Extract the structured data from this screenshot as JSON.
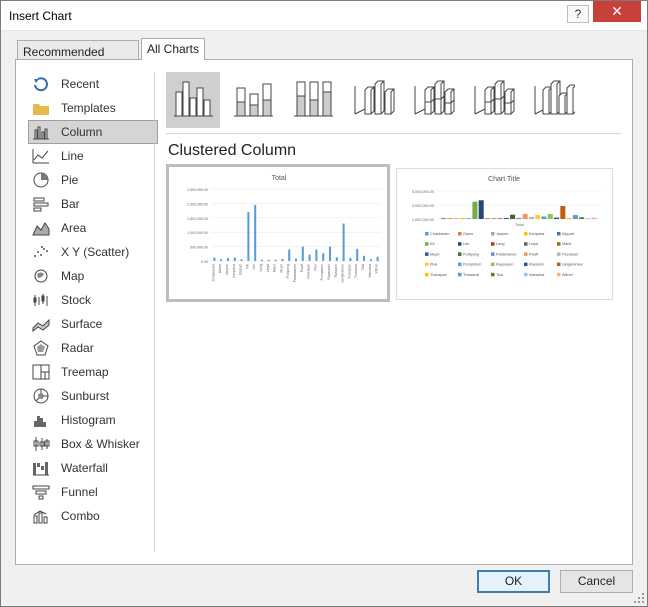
{
  "window": {
    "title": "Insert Chart",
    "help_glyph": "?",
    "close_glyph": "✕"
  },
  "tabs": [
    {
      "label": "Recommended Charts",
      "active": false
    },
    {
      "label": "All Charts",
      "active": true
    }
  ],
  "sidebar": {
    "selected": "Column",
    "items": [
      {
        "label": "Recent",
        "icon": "recent-icon"
      },
      {
        "label": "Templates",
        "icon": "folder-icon"
      },
      {
        "label": "Column",
        "icon": "column-chart-icon"
      },
      {
        "label": "Line",
        "icon": "line-chart-icon"
      },
      {
        "label": "Pie",
        "icon": "pie-chart-icon"
      },
      {
        "label": "Bar",
        "icon": "bar-chart-icon"
      },
      {
        "label": "Area",
        "icon": "area-chart-icon"
      },
      {
        "label": "X Y (Scatter)",
        "icon": "scatter-chart-icon"
      },
      {
        "label": "Map",
        "icon": "map-chart-icon"
      },
      {
        "label": "Stock",
        "icon": "stock-chart-icon"
      },
      {
        "label": "Surface",
        "icon": "surface-chart-icon"
      },
      {
        "label": "Radar",
        "icon": "radar-chart-icon"
      },
      {
        "label": "Treemap",
        "icon": "treemap-chart-icon"
      },
      {
        "label": "Sunburst",
        "icon": "sunburst-chart-icon"
      },
      {
        "label": "Histogram",
        "icon": "histogram-chart-icon"
      },
      {
        "label": "Box & Whisker",
        "icon": "box-whisker-chart-icon"
      },
      {
        "label": "Waterfall",
        "icon": "waterfall-chart-icon"
      },
      {
        "label": "Funnel",
        "icon": "funnel-chart-icon"
      },
      {
        "label": "Combo",
        "icon": "combo-chart-icon"
      }
    ]
  },
  "subtypes": {
    "selected_index": 0,
    "icons": [
      "clustered-column-icon",
      "stacked-column-icon",
      "100-stacked-column-icon",
      "3d-clustered-column-icon",
      "3d-stacked-column-icon",
      "3d-100-stacked-column-icon",
      "3d-column-icon"
    ]
  },
  "selected_subtype_name": "Clustered Column",
  "colors": {
    "accent_bar": "#5b9bd5",
    "selection_gray": "#d5d5d5",
    "close_red": "#c7413a",
    "primary_border": "#3c7fb1"
  },
  "previews": [
    {
      "selected": true,
      "chart_data": {
        "type": "bar",
        "title": "Total",
        "ylim": [
          0,
          2500000
        ],
        "ytick_labels": [
          "2,500,000.00",
          "2,000,000.00",
          "1,500,000.00",
          "1,000,000.00",
          "500,000.00",
          "0.00"
        ],
        "categories": [
          "Chakkaram",
          "Game",
          "Janpen",
          "Kanpana",
          "Kippart",
          "KK",
          "Lek",
          "Leng",
          "Lloyd",
          "Manit",
          "Mupri",
          "Puttipong",
          "Pattamanee",
          "Pawit",
          "Peerakan",
          "Pluk",
          "Pornpimon",
          "Rayanpen",
          "Rassarin",
          "sangkramee",
          "Thaospan",
          "Thawarat",
          "TAA",
          "Wanwisa",
          "Witnel"
        ],
        "values": [
          120000,
          60000,
          100000,
          120000,
          60000,
          1700000,
          1950000,
          40000,
          40000,
          40000,
          70000,
          400000,
          80000,
          500000,
          220000,
          400000,
          270000,
          500000,
          130000,
          1300000,
          110000,
          420000,
          180000,
          60000,
          150000
        ]
      }
    },
    {
      "selected": false,
      "chart_data": {
        "type": "bar",
        "title": "Chart Title",
        "xlabel": "Total",
        "ylim": [
          0,
          5000000
        ],
        "ytick_labels": [
          "5,000,000.00",
          "3,000,000.00",
          "1,000,000.00"
        ],
        "legend_position": "bottom",
        "series": [
          {
            "name": "Chakkaram",
            "value": 150000,
            "color": "#5b9bd5"
          },
          {
            "name": "Game",
            "value": 120000,
            "color": "#ed7d31"
          },
          {
            "name": "Janpen",
            "value": 100000,
            "color": "#a5a5a5"
          },
          {
            "name": "Kanpana",
            "value": 150000,
            "color": "#ffc000"
          },
          {
            "name": "Kippart",
            "value": 80000,
            "color": "#4472c4"
          },
          {
            "name": "KK",
            "value": 2400000,
            "color": "#70ad47"
          },
          {
            "name": "Lek",
            "value": 2600000,
            "color": "#264478"
          },
          {
            "name": "Leng",
            "value": 80000,
            "color": "#9e480e"
          },
          {
            "name": "Lloyd",
            "value": 80000,
            "color": "#636363"
          },
          {
            "name": "Manit",
            "value": 100000,
            "color": "#997300"
          },
          {
            "name": "Mupri",
            "value": 150000,
            "color": "#255e91"
          },
          {
            "name": "Puttipong",
            "value": 600000,
            "color": "#43682b"
          },
          {
            "name": "Pattamanee",
            "value": 150000,
            "color": "#698ed0"
          },
          {
            "name": "Pawit",
            "value": 700000,
            "color": "#f1975a"
          },
          {
            "name": "Peerakan",
            "value": 300000,
            "color": "#b7b7b7"
          },
          {
            "name": "Pluk",
            "value": 550000,
            "color": "#ffcd33"
          },
          {
            "name": "Pornpimon",
            "value": 350000,
            "color": "#5b9bd5"
          },
          {
            "name": "Rayanpen",
            "value": 700000,
            "color": "#8cc168"
          },
          {
            "name": "Rassarin",
            "value": 200000,
            "color": "#2f5597"
          },
          {
            "name": "sangkramee",
            "value": 1800000,
            "color": "#c55a11"
          },
          {
            "name": "Thaospan",
            "value": 150000,
            "color": "#ffc000"
          },
          {
            "name": "Thawarat",
            "value": 550000,
            "color": "#5b9bd5"
          },
          {
            "name": "TAA",
            "value": 250000,
            "color": "#548235"
          },
          {
            "name": "Wanwisa",
            "value": 100000,
            "color": "#9dc3e6"
          },
          {
            "name": "Witnel",
            "value": 200000,
            "color": "#f4b183"
          }
        ]
      }
    }
  ],
  "buttons": {
    "ok": "OK",
    "cancel": "Cancel"
  }
}
